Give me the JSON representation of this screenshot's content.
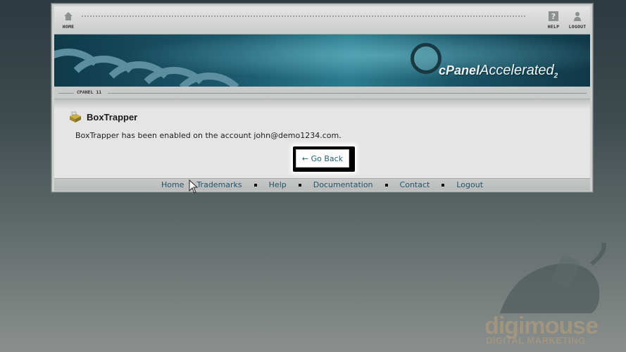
{
  "topbar": {
    "home_label": "HOME",
    "help_label": "HELP",
    "logout_label": "LOGOUT"
  },
  "banner": {
    "logo_brand": "cPanel",
    "logo_accel": "Accelerated",
    "logo_version": "2"
  },
  "breadcrumb": {
    "label": "CPANEL 11"
  },
  "content": {
    "title": "BoxTrapper",
    "message": "BoxTrapper has been enabled on the account john@demo1234.com.",
    "go_back_label": "← Go Back"
  },
  "footer": {
    "links": [
      "Home",
      "Trademarks",
      "Help",
      "Documentation",
      "Contact",
      "Logout"
    ]
  },
  "watermark": {
    "name": "digimouse",
    "tagline": "DIGITAL MARKETING"
  }
}
